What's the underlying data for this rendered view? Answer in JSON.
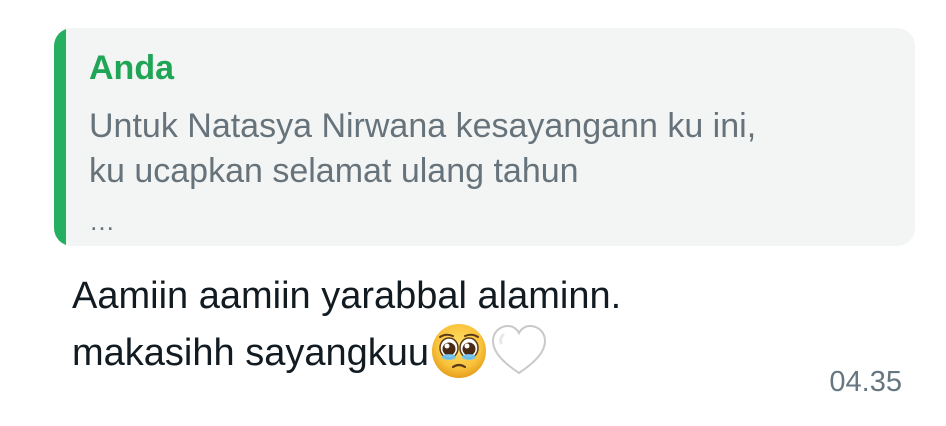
{
  "quoted_reply": {
    "author": "Anda",
    "lines": [
      "Untuk Natasya Nirwana kesayangann ku ini,",
      "ku ucapkan selamat ulang tahun"
    ],
    "ellipsis": "…",
    "accent_color": "#25b061"
  },
  "message": {
    "line1": "Aamiin aamiin yarabbal alaminn.",
    "line2": "makasihh sayangkuu",
    "emojis": [
      "pleading-face-icon",
      "white-heart-icon"
    ]
  },
  "timestamp": "04.35"
}
